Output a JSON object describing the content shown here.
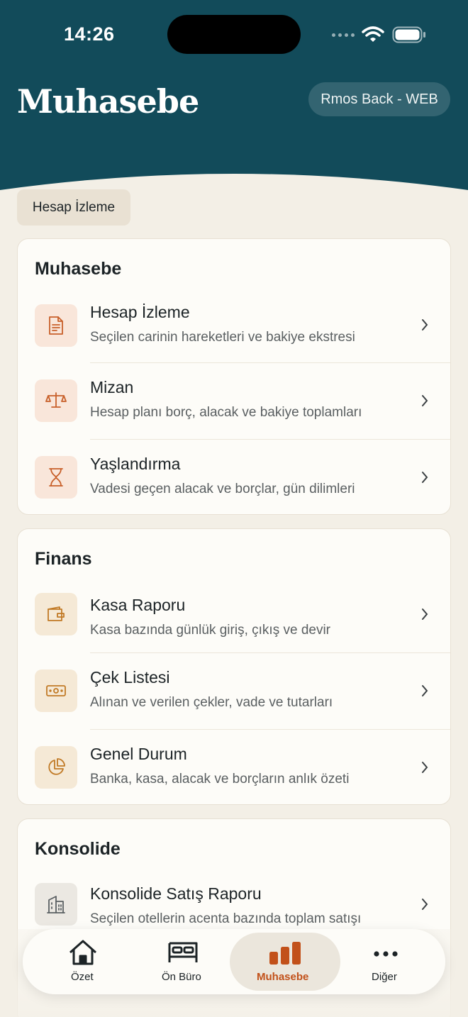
{
  "status": {
    "time": "14:26"
  },
  "header": {
    "title": "Muhasebe",
    "web_button": "Rmos Back - WEB"
  },
  "chip": {
    "label": "Hesap İzleme"
  },
  "sections": [
    {
      "title": "Muhasebe",
      "items": [
        {
          "title": "Hesap İzleme",
          "subtitle": "Seçilen carinin hareketleri ve bakiye ekstresi",
          "icon": "document-icon"
        },
        {
          "title": "Mizan",
          "subtitle": "Hesap planı borç, alacak ve bakiye toplamları",
          "icon": "scale-icon"
        },
        {
          "title": "Yaşlandırma",
          "subtitle": "Vadesi geçen alacak ve borçlar, gün dilimleri",
          "icon": "hourglass-icon"
        }
      ]
    },
    {
      "title": "Finans",
      "items": [
        {
          "title": "Kasa Raporu",
          "subtitle": "Kasa bazında günlük giriş, çıkış ve devir",
          "icon": "wallet-icon"
        },
        {
          "title": "Çek Listesi",
          "subtitle": "Alınan ve verilen çekler, vade ve tutarları",
          "icon": "banknote-icon"
        },
        {
          "title": "Genel Durum",
          "subtitle": "Banka, kasa, alacak ve borçların anlık özeti",
          "icon": "pie-chart-icon"
        }
      ]
    },
    {
      "title": "Konsolide",
      "items": [
        {
          "title": "Konsolide Satış Raporu",
          "subtitle": "Seçilen otellerin acenta bazında toplam satışı",
          "icon": "building-icon"
        }
      ]
    }
  ],
  "tabs": [
    {
      "label": "Özet",
      "icon": "home-icon"
    },
    {
      "label": "Ön Büro",
      "icon": "bed-icon"
    },
    {
      "label": "Muhasebe",
      "icon": "bar-chart-icon",
      "active": true
    },
    {
      "label": "Diğer",
      "icon": "more-icon"
    }
  ],
  "colors": {
    "header": "#124b5a",
    "accent": "#c2511a",
    "background": "#f3efe6"
  }
}
